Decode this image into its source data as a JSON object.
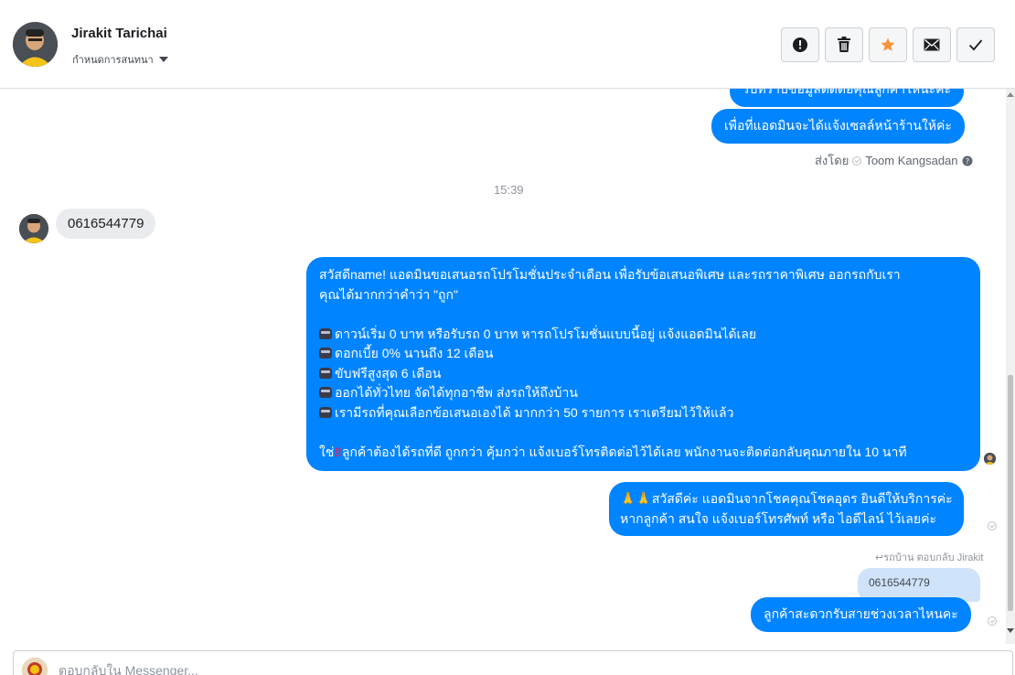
{
  "header": {
    "contact_name": "Jirakit Tarichai",
    "assign_label": "กำหนดการสนทนา",
    "toolbar": {
      "spam_icon": "alert-icon",
      "delete_icon": "trash-icon",
      "star_icon": "star-icon",
      "unread_icon": "envelope-icon",
      "done_icon": "check-icon"
    }
  },
  "thread": {
    "top_partial": "รับทราบข้อมูลติดต่อคุณลูกค้าให้นะคะ",
    "msg_admin_notify": "เพื่อที่แอดมินจะได้แจ้งเซลล์หน้าร้านให้ค่ะ",
    "sent_by_prefix": "ส่งโดย",
    "sent_by_name": "Toom Kangsadan",
    "timestamp": "15:39",
    "incoming_phone": "0616544779",
    "promo": {
      "intro_line1": "สวัสดีname! แอดมินขอเสนอรถโปรโมชั่นประจำเดือน เพื่อรับข้อเสนอพิเศษ และรถราคาพิเศษ ออกรถกับเรา",
      "intro_line2": "คุณได้มากกว่าคำว่า \"ถูก\"",
      "bullets": [
        "ดาวน์เริ่ม 0 บาท หรือรับรถ 0 บาท หารถโปรโมชั่นแบบนี้อยู่ แจ้งแอดมินได้เลย",
        "ดอกเบี้ย 0% นานถึง 12 เดือน",
        "ขับฟรีสูงสุด 6 เดือน",
        "ออกได้ทั่วไทย จัดได้ทุกอาชีพ ส่งรถให้ถึงบ้าน",
        "เรามีรถที่คุณเลือกข้อเสนอเองได้ มากกว่า 50 รายการ เราเตรียมไว้ให้แล้ว"
      ],
      "closing_prefix": "ใช่",
      "closing_text": "ลูกค้าต้องได้รถที่ดี ถูกกว่า คุ้มกว่า แจ้งเบอร์โทรติดต่อไว้ได้เลย พนักงานจะติดต่อกลับคุณภายใน 10 นาที"
    },
    "greeting_line1": "สวัสดีค่ะ แอดมินจากโชคคุณโชคอุดร ยินดีให้บริการค่ะ",
    "greeting_line2": "หากลูกค้า สนใจ แจ้งเบอร์โทรศัพท์ หรือ ไอดีไลน์  ไว้เลยค่ะ",
    "reply_meta": "รถบ้าน ตอบกลับ Jirakit",
    "reply_quote": "0616544779",
    "msg_ask_time": "ลูกค้าสะดวกรับสายช่วงเวลาไหนคะ"
  },
  "composer": {
    "placeholder": "ตอบกลับใน Messenger..."
  },
  "colors": {
    "outgoing_bubble": "#0084ff",
    "incoming_bubble": "#e9ebee",
    "star": "#f7923b",
    "reply_quote_bg": "#cfe3fb"
  }
}
